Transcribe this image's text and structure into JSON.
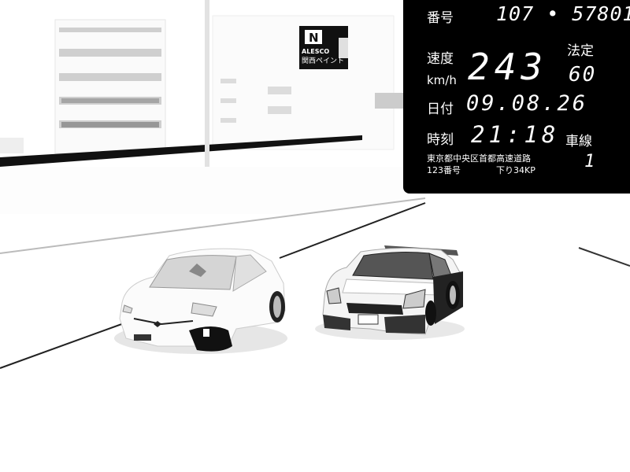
{
  "scene": {
    "sign": {
      "logo_letter": "N",
      "brand": "ALESCO",
      "caption": "関西ペイント"
    }
  },
  "hud": {
    "plate_label": "番号",
    "plate_number": "107 • 57801",
    "speed_label": "速度",
    "speed_unit": "km/h",
    "speed_value": "243",
    "legal_label": "法定",
    "legal_value": "60",
    "date_label": "日付",
    "date_value": "09.08.26",
    "time_label": "時刻",
    "time_value": "21:18",
    "lane_label": "車線",
    "lane_value": "1",
    "location_line1": "東京都中央区首都高速道路",
    "location_line2": "123番号",
    "direction": "下り34KP"
  },
  "colors": {
    "hud_bg": "#000000",
    "hud_text": "#ffffff",
    "scene_bg": "#ffffff",
    "road_line": "#111111"
  }
}
